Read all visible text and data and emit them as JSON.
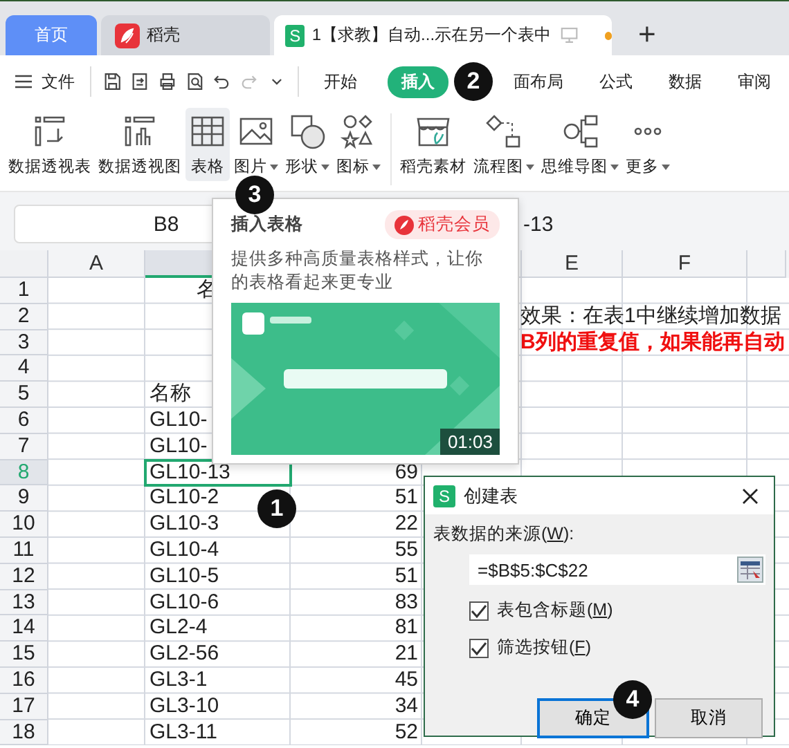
{
  "doc_tabs": [
    {
      "kind": "home",
      "label": "首页",
      "selected": false
    },
    {
      "kind": "docer",
      "label": "稻壳",
      "selected": false
    },
    {
      "kind": "sheet",
      "icon_letter": "S",
      "label": "1【求教】自动...示在另一个表中",
      "selected": true,
      "unsaved": true
    }
  ],
  "new_tab": "+",
  "menu": {
    "file": "文件",
    "quick_tools": [
      {
        "disabled": false
      },
      {
        "disabled": false
      },
      {
        "disabled": false
      },
      {
        "disabled": false
      },
      {
        "disabled": false
      },
      {
        "disabled": true
      },
      {
        "disabled": false
      }
    ],
    "tabs": [
      {
        "label": "开始",
        "selected": false
      },
      {
        "label": "插入",
        "selected": true
      },
      {
        "label": "面布局",
        "selected": false
      },
      {
        "label": "公式",
        "selected": false
      },
      {
        "label": "数据",
        "selected": false
      },
      {
        "label": "审阅",
        "selected": false
      }
    ]
  },
  "ribbon": [
    {
      "label": "数据透视表",
      "dropdown": false,
      "selected": false
    },
    {
      "label": "数据透视图",
      "dropdown": false,
      "selected": false
    },
    {
      "label": "表格",
      "dropdown": false,
      "selected": true
    },
    {
      "label": "图片",
      "dropdown": true,
      "selected": false
    },
    {
      "label": "形状",
      "dropdown": true,
      "selected": false
    },
    {
      "label": "图标",
      "dropdown": true,
      "selected": false
    },
    {
      "label": "稻壳素材",
      "dropdown": false,
      "selected": false
    },
    {
      "label": "流程图",
      "dropdown": true,
      "selected": false
    },
    {
      "label": "思维导图",
      "dropdown": true,
      "selected": false
    },
    {
      "label": "更多",
      "dropdown": true,
      "selected": false
    }
  ],
  "formula_bar": {
    "name_box": "B8",
    "formula": "-13"
  },
  "sheet": {
    "columns": [
      {
        "label": "A",
        "selected": false
      },
      {
        "selected": true
      },
      null,
      null,
      {
        "label": "E",
        "selected": false
      },
      {
        "label": "F",
        "selected": false
      },
      {
        "selected": false
      }
    ],
    "rows": [
      {
        "header": "1",
        "selected": false,
        "kind": "title",
        "b": "名"
      },
      {
        "header": "2",
        "selected": false,
        "kind": "note",
        "d": "效果：在表1中继续增加数据"
      },
      {
        "header": "3",
        "selected": false,
        "kind": "warning",
        "d": "B列的重复值，如果能再自动"
      },
      {
        "header": "4",
        "selected": false,
        "kind": "data"
      },
      {
        "header": "5",
        "selected": false,
        "kind": "data",
        "b": "名称"
      },
      {
        "header": "6",
        "selected": false,
        "kind": "data",
        "b": "GL10-"
      },
      {
        "header": "7",
        "selected": false,
        "kind": "data",
        "b": "GL10-"
      },
      {
        "header": "8",
        "selected": true,
        "kind": "data",
        "b": "GL10-13",
        "c": "69"
      },
      {
        "header": "9",
        "selected": false,
        "kind": "data",
        "b": "GL10-2",
        "c": "51"
      },
      {
        "header": "10",
        "selected": false,
        "kind": "data",
        "b": "GL10-3",
        "c": "22"
      },
      {
        "header": "11",
        "selected": false,
        "kind": "data",
        "b": "GL10-4",
        "c": "55"
      },
      {
        "header": "12",
        "selected": false,
        "kind": "data",
        "b": "GL10-5",
        "c": "51"
      },
      {
        "header": "13",
        "selected": false,
        "kind": "data",
        "b": "GL10-6",
        "c": "83"
      },
      {
        "header": "14",
        "selected": false,
        "kind": "data",
        "b": "GL2-4",
        "c": "81"
      },
      {
        "header": "15",
        "selected": false,
        "kind": "data",
        "b": "GL2-56",
        "c": "21"
      },
      {
        "header": "16",
        "selected": false,
        "kind": "data",
        "b": "GL3-1",
        "c": "45"
      },
      {
        "header": "17",
        "selected": false,
        "kind": "data",
        "b": "GL3-10",
        "c": "34"
      },
      {
        "header": "18",
        "selected": false,
        "kind": "data",
        "b": "GL3-11",
        "c": "52"
      }
    ]
  },
  "popup": {
    "title": "插入表格",
    "badge": "稻壳会员",
    "description": "提供多种高质量表格样式，让你的表格看起来更专业",
    "video": {
      "kind": "picture",
      "duration": "01:03"
    }
  },
  "dialog": {
    "icon_letter": "S",
    "title": "创建表",
    "source_label": {
      "text": "表数据的来源(",
      "access_key": "W",
      "end": "):"
    },
    "source_value": "=$B$5:$C$22",
    "options": [
      {
        "text": "表包含标题(",
        "access_key": "M",
        "end": ")",
        "checked": true
      },
      {
        "text": "筛选按钮(",
        "access_key": "F",
        "end": ")",
        "checked": true
      }
    ],
    "buttons": [
      {
        "label": "确定",
        "default": true
      },
      {
        "label": "取消",
        "default": false
      }
    ]
  },
  "steps": [
    "1",
    "2",
    "3",
    "4"
  ]
}
